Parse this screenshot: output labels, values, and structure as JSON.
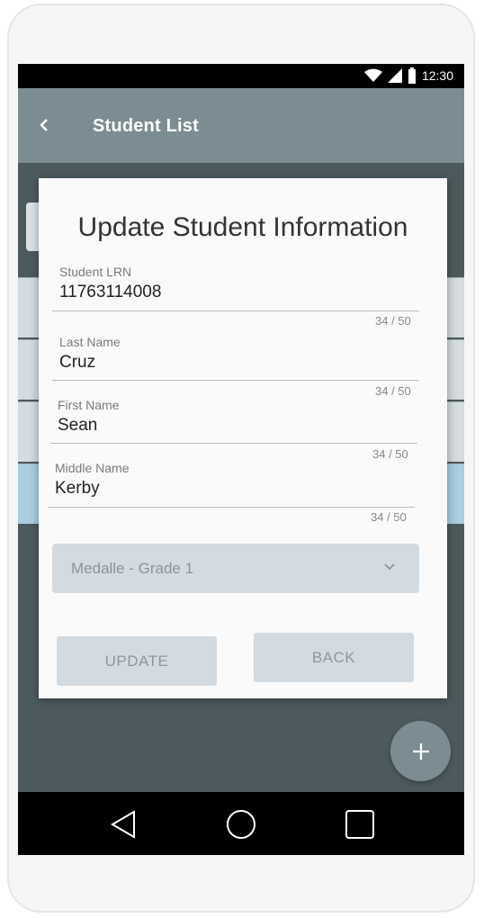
{
  "status_bar": {
    "time": "12:30"
  },
  "app_bar": {
    "title": "Student List"
  },
  "dialog": {
    "title": "Update Student Information",
    "fields": [
      {
        "label": "Student LRN",
        "value": "11763114008",
        "counter": "34 / 50"
      },
      {
        "label": "Last Name",
        "value": "Cruz",
        "counter": "34 / 50"
      },
      {
        "label": "First Name",
        "value": "Sean",
        "counter": "34 / 50"
      },
      {
        "label": "Middle Name",
        "value": "Kerby",
        "counter": "34 / 50"
      }
    ],
    "section_select": {
      "value": "Medalle - Grade 1"
    },
    "update_label": "UPDATE",
    "back_label": "BACK"
  },
  "colors": {
    "app_bar": "#7b8d92",
    "screen_bg": "#4c5a5e",
    "button_bg": "#d3dbe1",
    "selected_row": "#a9cfe0"
  },
  "icons": {
    "back": "chevron-left-icon",
    "fab": "plus-icon",
    "nav": [
      "back-triangle-icon",
      "home-circle-icon",
      "recents-square-icon"
    ]
  }
}
